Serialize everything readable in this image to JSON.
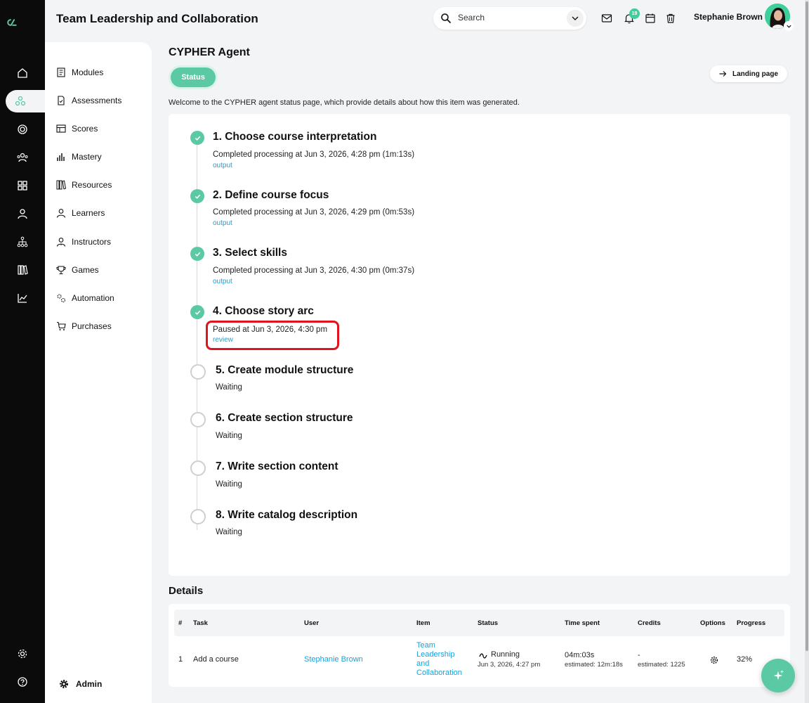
{
  "header": {
    "app_title": "Team Leadership and Collaboration",
    "search_placeholder": "Search",
    "notification_count": "19",
    "user_name": "Stephanie Brown"
  },
  "rail": {
    "icons": [
      "logo-icon",
      "home-icon",
      "network-icon",
      "target-icon",
      "users-icon",
      "grid-icon",
      "user-icon",
      "hierarchy-icon",
      "library-icon",
      "chart-icon",
      "settings-icon",
      "help-icon"
    ]
  },
  "sidebar": {
    "items": [
      {
        "label": "Modules",
        "icon": "modules-icon"
      },
      {
        "label": "Assessments",
        "icon": "assessments-icon"
      },
      {
        "label": "Scores",
        "icon": "scores-icon"
      },
      {
        "label": "Mastery",
        "icon": "mastery-icon"
      },
      {
        "label": "Resources",
        "icon": "resources-icon"
      },
      {
        "label": "Learners",
        "icon": "learners-icon"
      },
      {
        "label": "Instructors",
        "icon": "instructors-icon"
      },
      {
        "label": "Games",
        "icon": "games-icon"
      },
      {
        "label": "Automation",
        "icon": "automation-icon"
      },
      {
        "label": "Purchases",
        "icon": "purchases-icon"
      }
    ],
    "admin_label": "Admin"
  },
  "main": {
    "title": "CYPHER Agent",
    "status_tab": "Status",
    "landing_button": "Landing page",
    "intro": "Welcome to the CYPHER agent status page, which provide details about how this item was generated."
  },
  "steps": [
    {
      "title": "1. Choose course interpretation",
      "desc": "Completed processing at Jun 3, 2026, 4:28 pm (1m:13s)",
      "link": "output",
      "done": true
    },
    {
      "title": "2. Define course focus",
      "desc": "Completed processing at Jun 3, 2026, 4:29 pm (0m:53s)",
      "link": "output",
      "done": true
    },
    {
      "title": "3. Select skills",
      "desc": "Completed processing at Jun 3, 2026, 4:30 pm (0m:37s)",
      "link": "output",
      "done": true
    },
    {
      "title": "4. Choose story arc",
      "desc": "Paused at Jun 3, 2026, 4:30 pm",
      "link": "review",
      "done": true
    },
    {
      "title": "5. Create module structure",
      "desc": "Waiting",
      "done": false
    },
    {
      "title": "6. Create section structure",
      "desc": "Waiting",
      "done": false
    },
    {
      "title": "7. Write section content",
      "desc": "Waiting",
      "done": false
    },
    {
      "title": "8. Write catalog description",
      "desc": "Waiting",
      "done": false
    }
  ],
  "details": {
    "title": "Details",
    "columns": [
      "#",
      "Task",
      "User",
      "Item",
      "Status",
      "Time spent",
      "Credits",
      "Options",
      "Progress"
    ],
    "row": {
      "num": "1",
      "task": "Add a course",
      "user": "Stephanie Brown",
      "item_lines": [
        "Team",
        "Leadership",
        "and",
        "Collaboration"
      ],
      "status": "Running",
      "status_date": "Jun 3, 2026, 4:27 pm",
      "time_spent": "04m:03s",
      "time_estimated": "estimated: 12m:18s",
      "credits": "-",
      "credits_estimated": "estimated: 1225",
      "progress": "32%"
    }
  },
  "colors": {
    "accent": "#5bc9a3",
    "link": "#1aa1d6",
    "highlight": "#e0141e",
    "rail": "#0b0b0b"
  }
}
